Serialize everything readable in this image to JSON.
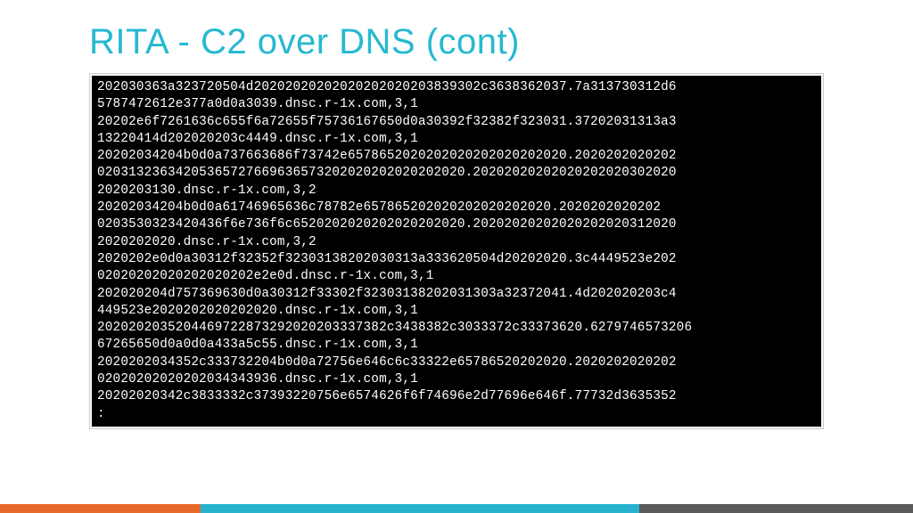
{
  "title": "RITA - C2 over DNS (cont)",
  "terminal_lines": [
    "202030363a323720504d20202020202020202020203839302c3638362037.7a313730312d6",
    "5787472612e377a0d0a3039.dnsc.r-1x.com,3,1",
    "20202e6f7261636c655f6a72655f75736167650d0a30392f32382f323031.37202031313a3",
    "13220414d202020203c4449.dnsc.r-1x.com,3,1",
    "20202034204b0d0a737663686f73742e6578652020202020202020202020.2020202020202",
    "02031323634205365727669636573202020202020202020.20202020202020202020302020",
    "2020203130.dnsc.r-1x.com,3,2",
    "20202034204b0d0a61746965636c78782e657865202020202020202020.2020202020202",
    "0203530323420436f6e736f6c6520202020202020202020.20202020202020202020312020",
    "2020202020.dnsc.r-1x.com,3,2",
    "2020202e0d0a30312f32352f32303138202030313a333620504d20202020.3c4449523e202",
    "02020202020202020202e2e0d.dnsc.r-1x.com,3,1",
    "202020204d757369630d0a30312f33302f32303138202031303a32372041.4d202020203c4",
    "449523e2020202020202020.dnsc.r-1x.com,3,1",
    "2020202035204469722873292020203337382c3438382c3033372c33373620.6279746573206",
    "67265650d0a0d0a433a5c55.dnsc.r-1x.com,3,1",
    "2020202034352c333732204b0d0a72756e646c6c33322e65786520202020.2020202020202",
    "02020202020202034343936.dnsc.r-1x.com,3,1",
    "20202020342c3833332c37393220756e6574626f6f74696e2d77696e646f.77732d3635352",
    ":"
  ],
  "footer_colors": {
    "seg1": "#e86a2a",
    "seg2": "#27b3ce",
    "seg3": "#5a5a5a"
  }
}
